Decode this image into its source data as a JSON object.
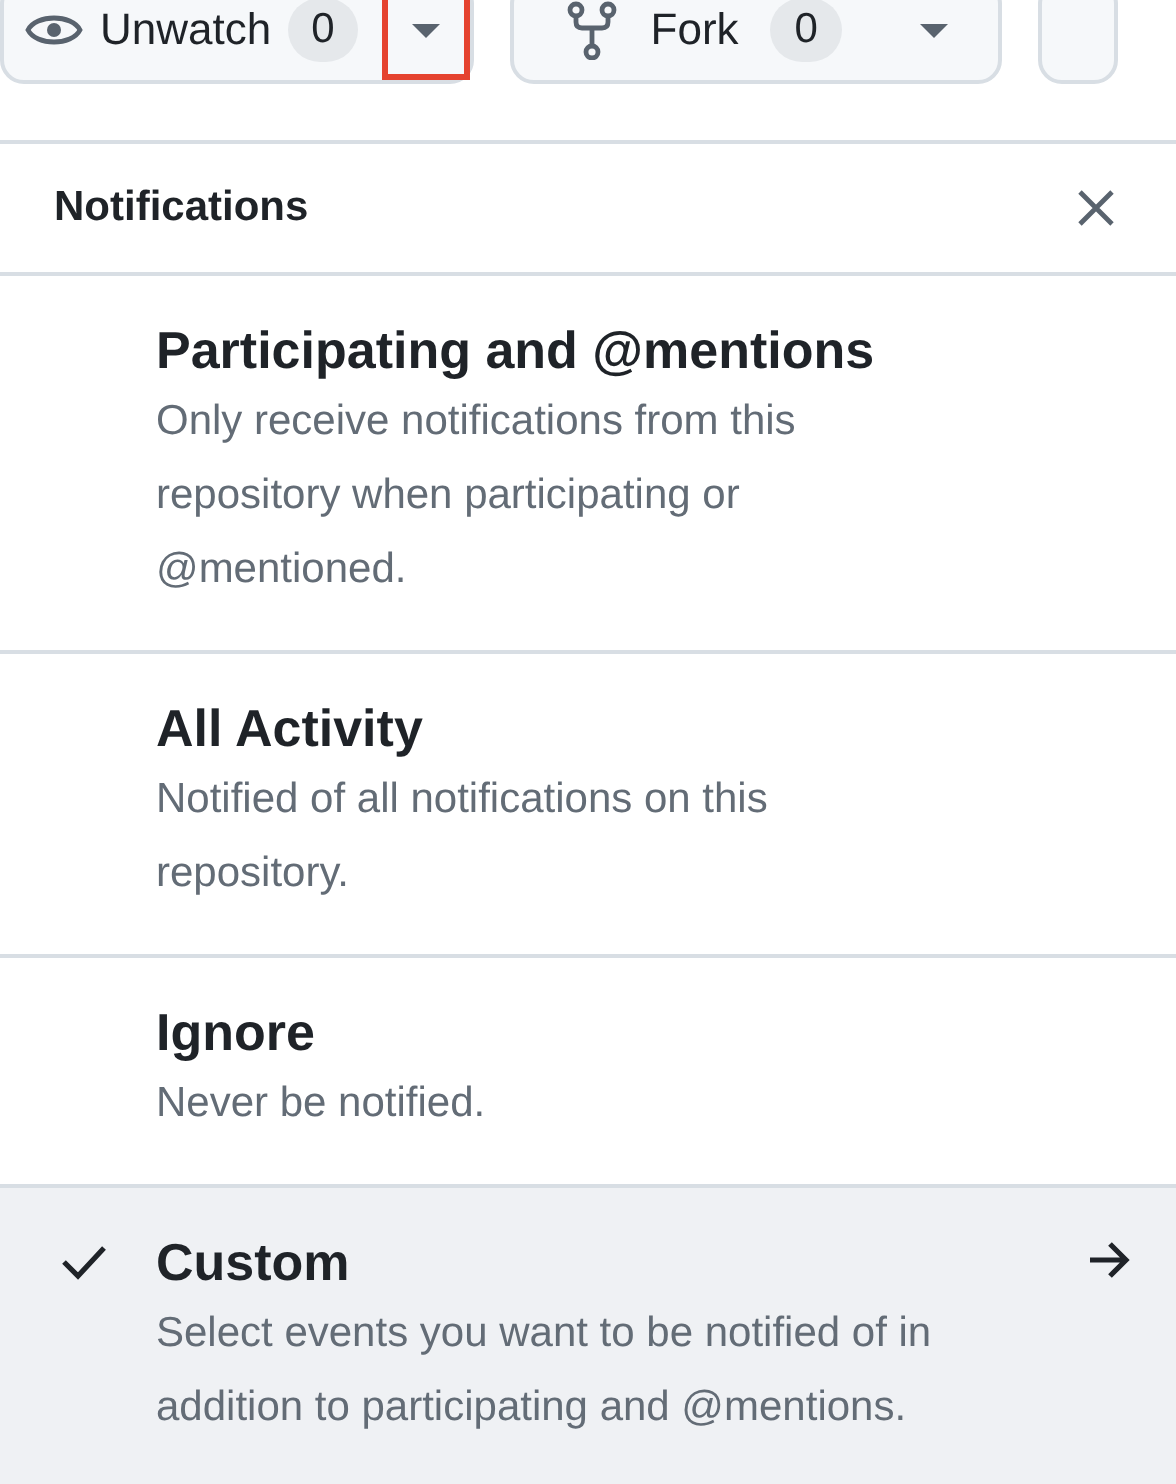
{
  "toolbar": {
    "watch_button": {
      "label": "Unwatch",
      "count": "0",
      "caret_highlighted": true
    },
    "fork_button": {
      "label": "Fork",
      "count": "0"
    }
  },
  "menu": {
    "title": "Notifications",
    "items": [
      {
        "kind": "option",
        "title": "Participating and @mentions",
        "description": "Only receive notifications from this repository when participating or @mentioned.",
        "selected": false
      },
      {
        "kind": "option",
        "title": "All Activity",
        "description": "Notified of all notifications on this repository.",
        "selected": false
      },
      {
        "kind": "option",
        "title": "Ignore",
        "description": "Never be notified.",
        "selected": false
      },
      {
        "kind": "submenu",
        "title": "Custom",
        "description": "Select events you want to be notified of in addition to participating and @mentions.",
        "selected": true
      }
    ]
  }
}
